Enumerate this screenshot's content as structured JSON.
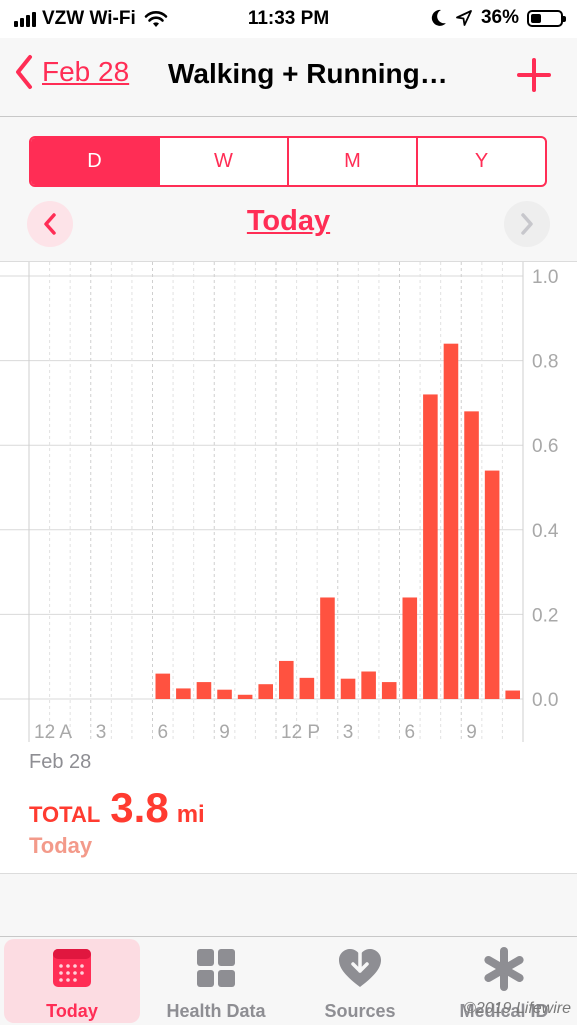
{
  "status_bar": {
    "carrier": "VZW Wi-Fi",
    "time": "11:33 PM",
    "battery": "36%",
    "battery_level": 0.36
  },
  "nav": {
    "back_label": "Feb 28",
    "title": "Walking + Running…",
    "add_icon": "plus-icon"
  },
  "segments": [
    {
      "label": "D",
      "active": true
    },
    {
      "label": "W",
      "active": false
    },
    {
      "label": "M",
      "active": false
    },
    {
      "label": "Y",
      "active": false
    }
  ],
  "period_label": "Today",
  "chart_data": {
    "type": "bar",
    "x_tick_labels": [
      "12 A",
      "3",
      "6",
      "9",
      "12 P",
      "3",
      "6",
      "9"
    ],
    "y_tick_labels": [
      "1.0",
      "0.8",
      "0.6",
      "0.4",
      "0.2",
      "0.0"
    ],
    "ylim": [
      0,
      1.0
    ],
    "hours": [
      0,
      1,
      2,
      3,
      4,
      5,
      6,
      7,
      8,
      9,
      10,
      11,
      12,
      13,
      14,
      15,
      16,
      17,
      18,
      19,
      20,
      21,
      22,
      23
    ],
    "values": [
      0,
      0,
      0,
      0,
      0,
      0,
      0.06,
      0.025,
      0.04,
      0.022,
      0.01,
      0.035,
      0.09,
      0.05,
      0.24,
      0.048,
      0.065,
      0.04,
      0.24,
      0.72,
      0.84,
      0.68,
      0.54,
      0.02
    ],
    "bar_color": "#ff5240",
    "grid": true
  },
  "summary": {
    "date": "Feb 28",
    "total_label": "TOTAL",
    "total_value": "3.8",
    "unit": "mi",
    "sub_label": "Today"
  },
  "tabs": [
    {
      "label": "Today",
      "icon": "calendar-icon",
      "active": true
    },
    {
      "label": "Health Data",
      "icon": "grid-icon",
      "active": false
    },
    {
      "label": "Sources",
      "icon": "heart-download-icon",
      "active": false
    },
    {
      "label": "Medical ID",
      "icon": "asterisk-icon",
      "active": false
    }
  ],
  "watermark": "©2019 Lifewire"
}
